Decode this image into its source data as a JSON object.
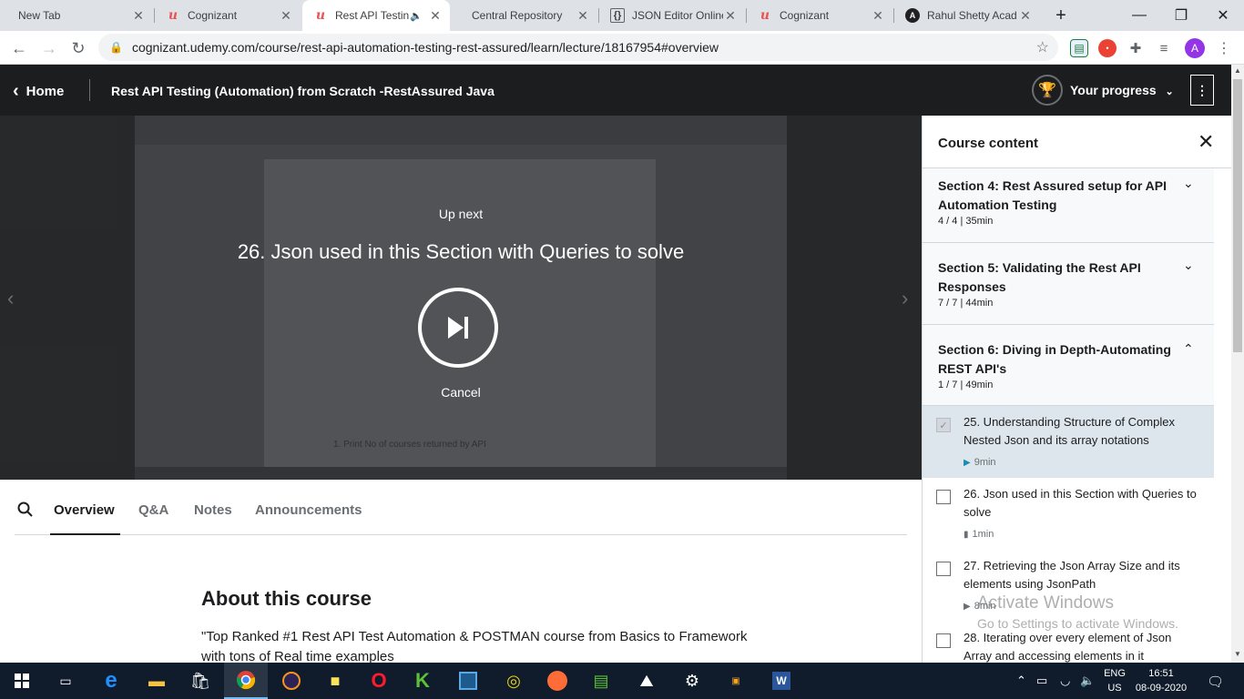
{
  "browser": {
    "tabs": [
      {
        "title": "New Tab",
        "favicon": "none"
      },
      {
        "title": "Cognizant",
        "favicon": "udemy-icon"
      },
      {
        "title": "Rest API Testin",
        "favicon": "udemy-icon",
        "active": true,
        "audio": true
      },
      {
        "title": "Central Repository",
        "favicon": "none"
      },
      {
        "title": "JSON Editor Online",
        "favicon": "braces-icon"
      },
      {
        "title": "Cognizant",
        "favicon": "udemy-icon"
      },
      {
        "title": "Rahul Shetty Acad",
        "favicon": "angular-icon"
      }
    ],
    "url": "cognizant.udemy.com/course/rest-api-automation-testing-rest-assured/learn/lecture/18167954#overview",
    "profile_initial": "A"
  },
  "header": {
    "home_label": "Home",
    "course_title": "Rest API Testing (Automation) from Scratch -RestAssured Java",
    "progress_label": "Your progress"
  },
  "video": {
    "up_next_label": "Up next",
    "next_title": "26. Json used in this Section with Queries to solve",
    "cancel_label": "Cancel",
    "frame_caption": "1. Print No of courses returned by API"
  },
  "sidebar": {
    "title": "Course content",
    "sections": [
      {
        "title": "Section 4: Rest Assured setup for API Automation Testing",
        "meta": "4 / 4 | 35min",
        "expanded": false
      },
      {
        "title": "Section 5: Validating the Rest API Responses",
        "meta": "7 / 7 | 44min",
        "expanded": false
      },
      {
        "title": "Section 6: Diving in Depth-Automating REST API's",
        "meta": "1 / 7 | 49min",
        "expanded": true
      }
    ],
    "lectures": [
      {
        "title": "25. Understanding Structure of Complex Nested Json and its array notations",
        "duration": "9min",
        "type": "video",
        "completed": true,
        "active": true
      },
      {
        "title": "26. Json used in this Section with Queries to solve",
        "duration": "1min",
        "type": "article",
        "completed": false
      },
      {
        "title": "27. Retrieving the Json Array Size and its elements using JsonPath",
        "duration": "8min",
        "type": "video",
        "completed": false
      },
      {
        "title": "28. Iterating over every element of Json Array and accessing elements in it",
        "duration": "",
        "type": "video",
        "completed": false
      }
    ]
  },
  "tabs_bottom": [
    "Overview",
    "Q&A",
    "Notes",
    "Announcements"
  ],
  "about": {
    "heading": "About this course",
    "description": "\"Top Ranked #1 Rest API Test Automation & POSTMAN course from Basics to Framework with tons of Real time examples"
  },
  "watermark": {
    "line1": "Activate Windows",
    "line2": "Go to Settings to activate Windows."
  },
  "taskbar": {
    "lang_top": "ENG",
    "lang_bottom": "US",
    "time": "16:51",
    "date": "08-09-2020"
  },
  "colors": {
    "udemy_red": "#ec5252",
    "header_bg": "#1c1d1f",
    "taskbar_bg": "#101c2b"
  }
}
